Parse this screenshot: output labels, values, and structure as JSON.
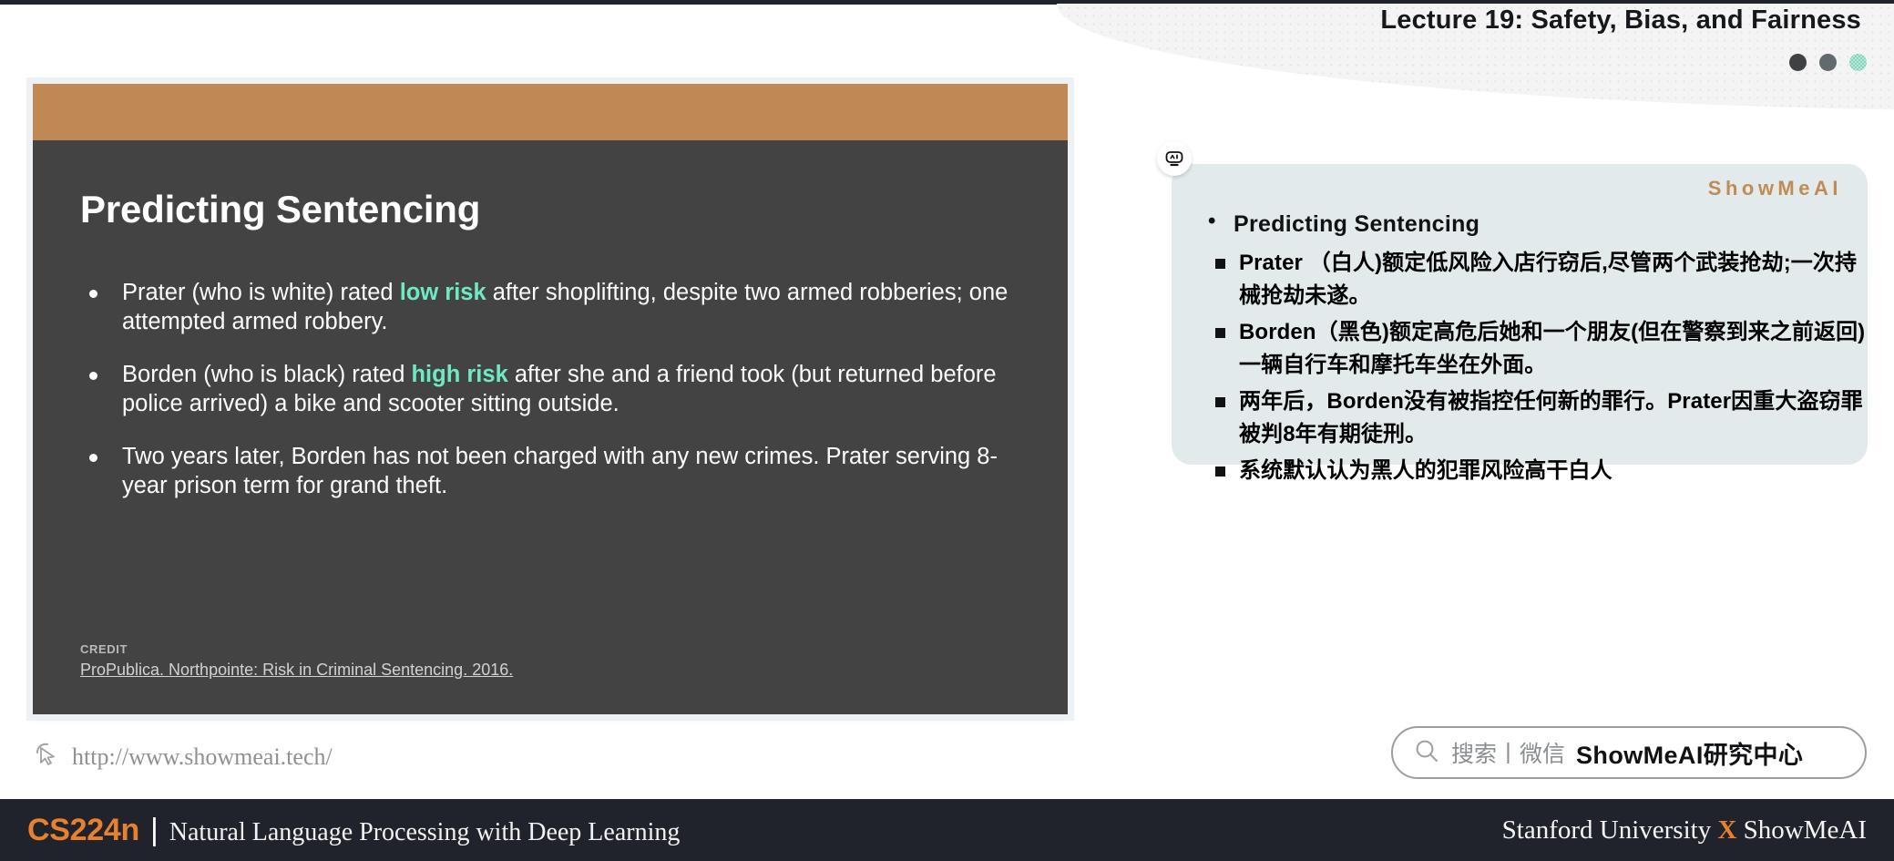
{
  "header": {
    "title": "Lecture 19: Safety, Bias, and Fairness",
    "dots": [
      "dark-dot",
      "gray-dot",
      "teal-dot"
    ],
    "colors": {
      "dot1": "#3f4245",
      "dot2": "#616b6e",
      "dot3": "#7fd6bd"
    }
  },
  "slide": {
    "accent_bar_color": "#bf8854",
    "background_color": "#434343",
    "title": "Predicting Sentencing",
    "highlight_color": "#6fe8c4",
    "bullets": [
      {
        "pre": "Prater (who is white) rated ",
        "highlight": "low risk",
        "post": " after shoplifting, despite two armed robberies; one attempted armed robbery."
      },
      {
        "pre": "Borden (who is black) rated ",
        "highlight": "high risk",
        "post": " after she and a friend took (but returned before police arrived) a bike and scooter sitting outside."
      },
      {
        "pre": "Two years later, Borden has not been charged with any new crimes. Prater serving 8-year prison term for grand theft.",
        "highlight": "",
        "post": ""
      }
    ],
    "credit_label": "CREDIT",
    "credit_link": "ProPublica. Northpointe: Risk in Criminal Sentencing. 2016."
  },
  "notes_panel": {
    "brand": "ShowMeAI",
    "brand_color": "#c08b55",
    "background_color": "#e3eaec",
    "heading": "Predicting Sentencing",
    "items": [
      "Prater （白人)额定低风险入店行窃后,尽管两个武装抢劫;一次持械抢劫未遂。",
      "Borden（黑色)额定高危后她和一个朋友(但在警察到来之前返回)一辆自行车和摩托车坐在外面。",
      "两年后，Borden没有被指控任何新的罪行。Prater因重大盗窃罪被判8年有期徒刑。",
      "系统默认认为黑人的犯罪风险高干白人"
    ]
  },
  "site": {
    "url": "http://www.showmeai.tech/",
    "cursor_icon": "cursor-pointer-icon"
  },
  "search": {
    "icon": "search-icon",
    "placeholder": "搜索丨微信",
    "value": "ShowMeAI研究中心"
  },
  "footer": {
    "course_code": "CS224n",
    "separator": "|",
    "course_name": "Natural Language Processing with Deep Learning",
    "right_prefix": "Stanford University ",
    "right_x": "X",
    "right_suffix": " ShowMeAI",
    "accent_color": "#e8812e"
  }
}
